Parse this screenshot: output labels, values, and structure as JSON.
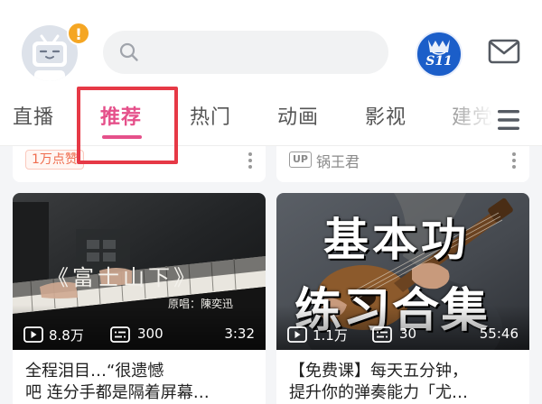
{
  "header": {
    "notification_badge": "!",
    "search_placeholder": "",
    "event_logo_text": "S11",
    "colors": {
      "accent": "#e5508a",
      "badge": "#f5a623",
      "event_logo_bg": "#1b5ec9"
    }
  },
  "tabs": {
    "items": [
      {
        "label": "直播",
        "active": false
      },
      {
        "label": "推荐",
        "active": true
      },
      {
        "label": "热门",
        "active": false
      },
      {
        "label": "动画",
        "active": false
      },
      {
        "label": "影视",
        "active": false
      },
      {
        "label": "建党",
        "active": false
      }
    ],
    "menu_icon": "hamburger-icon"
  },
  "feed": {
    "previous_cards": {
      "left": {
        "promo_tag": "1万点赞"
      },
      "right": {
        "up_tag": "UP",
        "up_name": "锅王君"
      }
    },
    "cards": [
      {
        "thumbnail_text": "《富士山下》",
        "thumbnail_credit": "原唱：陳奕迅",
        "views": "8.8万",
        "danmaku": "300",
        "duration": "3:32",
        "title_line1": "全程泪目…“很遗憾",
        "title_line2": "吧 连分手都是隔着屏幕…"
      },
      {
        "thumbnail_text_line1": "基本功",
        "thumbnail_text_line2": "练习合集",
        "views": "1.1万",
        "danmaku": "30",
        "duration": "55:46",
        "title_line1": "【免费课】每天五分钟，",
        "title_line2": "提升你的弹奏能力「尤…"
      }
    ]
  }
}
